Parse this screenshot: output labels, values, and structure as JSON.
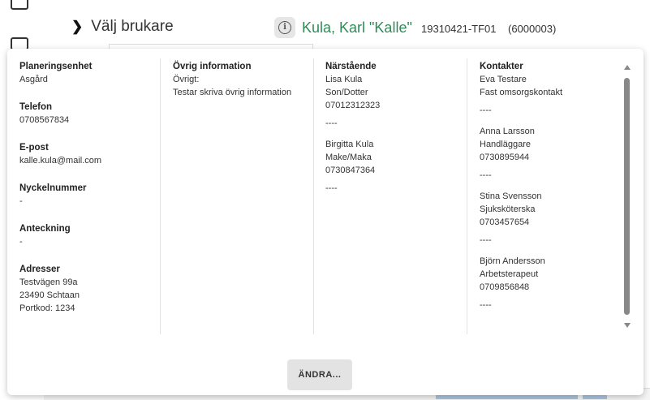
{
  "header": {
    "select_user": "Välj brukare",
    "patient_name": "Kula, Karl \"Kalle\"",
    "patient_id": "19310421-TF01",
    "patient_code": "(6000003)"
  },
  "popup": {
    "col1": {
      "planning_unit_label": "Planeringsenhet",
      "planning_unit_value": "Asgård",
      "phone_label": "Telefon",
      "phone_value": "0708567834",
      "email_label": "E-post",
      "email_value": "kalle.kula@mail.com",
      "key_number_label": "Nyckelnummer",
      "key_number_value": "-",
      "note_label": "Anteckning",
      "note_value": "-",
      "addresses_label": "Adresser",
      "address_lines": [
        "Testvägen 99a",
        "23490 Schtaan",
        "Portkod: 1234"
      ]
    },
    "col2": {
      "other_info_label": "Övrig information",
      "other_label": "Övrigt:",
      "other_text": "Testar skriva övrig information"
    },
    "col3": {
      "relatives_label": "Närstående",
      "relatives": [
        {
          "name": "Lisa Kula",
          "relation": "Son/Dotter",
          "phone": "07012312323",
          "sep": "----"
        },
        {
          "name": "Birgitta Kula",
          "relation": "Make/Maka",
          "phone": "0730847364",
          "sep": "----"
        }
      ]
    },
    "col4": {
      "contacts_label": "Kontakter",
      "contacts": [
        {
          "name": "Eva Testare",
          "role": "Fast omsorgskontakt",
          "phone": "",
          "sep": "----"
        },
        {
          "name": "Anna Larsson",
          "role": "Handläggare",
          "phone": "0730895944",
          "sep": "----"
        },
        {
          "name": "Stina Svensson",
          "role": "Sjuksköterska",
          "phone": "0703457654",
          "sep": "----"
        },
        {
          "name": "Björn Andersson",
          "role": "Arbetsterapeut",
          "phone": "0709856848",
          "sep": "----"
        }
      ]
    },
    "edit_label": "ÄNDRA..."
  }
}
